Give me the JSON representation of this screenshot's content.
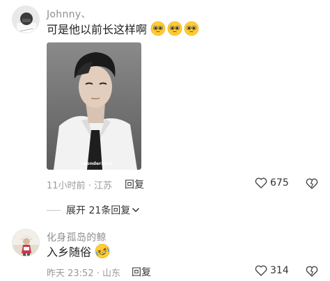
{
  "comments": [
    {
      "username": "Johnny、",
      "text": "可是他以前长这样啊",
      "emojis": [
        "pleading-face",
        "pleading-face",
        "pleading-face"
      ],
      "photo": {
        "watermark": "wonderland"
      },
      "meta": "11小时前 · 江苏",
      "reply_label": "回复",
      "likes": "675"
    },
    {
      "username": "化身孤岛的鲸",
      "text": "入乡随俗",
      "emojis": [
        "rolling-on-floor-laughing"
      ],
      "meta": "昨天 23:52 · 山东",
      "reply_label": "回复",
      "likes": "314"
    }
  ],
  "expand_replies": "展开 21条回复",
  "colors": {
    "username": "#8e8e8e",
    "meta": "#9a9a9a",
    "text": "#222222",
    "emoji_yellow": "#ffcc33"
  }
}
